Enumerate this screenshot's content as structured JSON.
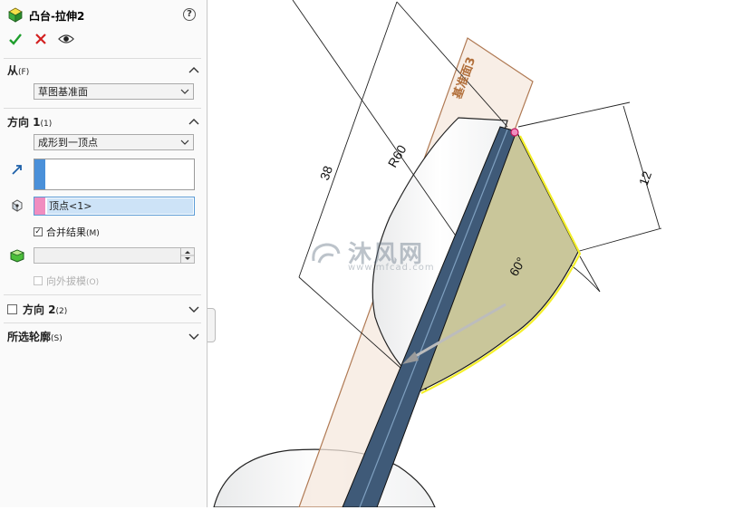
{
  "panel": {
    "title": "凸台-拉伸2",
    "help_glyph": "?",
    "from": {
      "heading": "从",
      "key": "(F)",
      "selected": "草图基准面"
    },
    "direction1": {
      "heading": "方向 1",
      "key": "(1)",
      "end_condition": "成形到一顶点",
      "vertex_value": "顶点<1>",
      "merge_label": "合并结果",
      "merge_key": "(M)",
      "merge_checked": "✓",
      "draft_label": "向外拔模",
      "draft_key": "(O)"
    },
    "direction2": {
      "heading": "方向 2",
      "key": "(2)"
    },
    "contours": {
      "heading": "所选轮廓",
      "key": "(S)"
    }
  },
  "viewport": {
    "plane_label": "基准面3",
    "dim_38": "38",
    "dim_r60": "R60",
    "dim_12": "12",
    "dim_60deg": "60°",
    "watermark_name": "沐风网",
    "watermark_url": "www.mfcad.com"
  },
  "colors": {
    "accent_blue": "#4a90d9",
    "selection_pink": "#f08dc0",
    "selection_field": "#cde3f7",
    "face_yellow": "#c9c69a",
    "bar_blue": "#3f5a78"
  }
}
